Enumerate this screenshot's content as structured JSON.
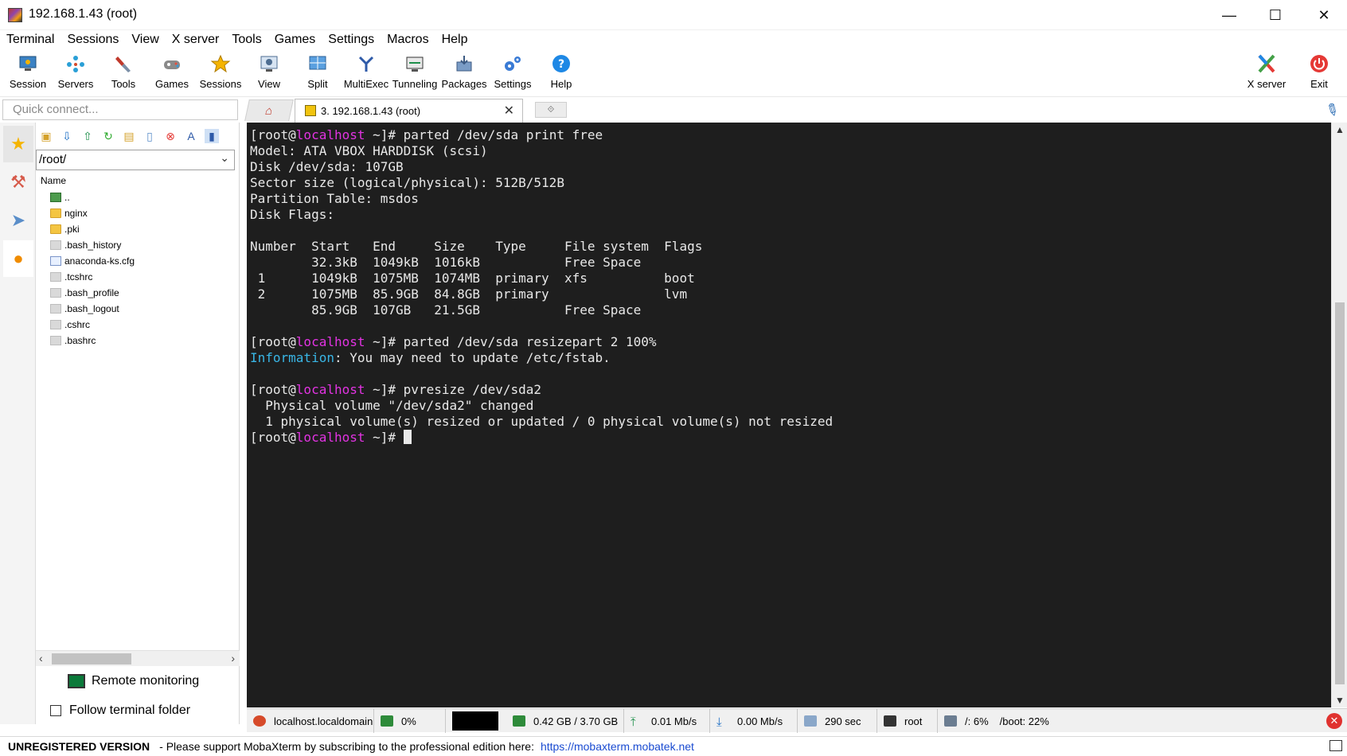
{
  "window": {
    "title": "192.168.1.43 (root)",
    "controls": {
      "minimize": "—",
      "maximize": "☐",
      "close": "✕"
    }
  },
  "menu": [
    "Terminal",
    "Sessions",
    "View",
    "X server",
    "Tools",
    "Games",
    "Settings",
    "Macros",
    "Help"
  ],
  "toolbar": [
    {
      "label": "Session",
      "icon": "session-icon"
    },
    {
      "label": "Servers",
      "icon": "servers-icon"
    },
    {
      "label": "Tools",
      "icon": "tools-icon"
    },
    {
      "label": "Games",
      "icon": "games-icon"
    },
    {
      "label": "Sessions",
      "icon": "star-icon"
    },
    {
      "label": "View",
      "icon": "view-icon"
    },
    {
      "label": "Split",
      "icon": "split-icon"
    },
    {
      "label": "MultiExec",
      "icon": "multiexec-icon"
    },
    {
      "label": "Tunneling",
      "icon": "tunneling-icon"
    },
    {
      "label": "Packages",
      "icon": "packages-icon"
    },
    {
      "label": "Settings",
      "icon": "settings-icon"
    },
    {
      "label": "Help",
      "icon": "help-icon"
    }
  ],
  "toolbar_right": [
    {
      "label": "X server",
      "icon": "xserver-icon"
    },
    {
      "label": "Exit",
      "icon": "power-icon"
    }
  ],
  "quick_connect": {
    "placeholder": "Quick connect..."
  },
  "tabs": {
    "active_label": "3. 192.168.1.43 (root)",
    "close_glyph": "✕"
  },
  "sftp": {
    "path": "/root/",
    "column_header": "Name",
    "files": [
      {
        "name": "..",
        "kind": "up"
      },
      {
        "name": "nginx",
        "kind": "folder"
      },
      {
        "name": ".pki",
        "kind": "folder"
      },
      {
        "name": ".bash_history",
        "kind": "file"
      },
      {
        "name": "anaconda-ks.cfg",
        "kind": "cfg"
      },
      {
        "name": ".tcshrc",
        "kind": "file"
      },
      {
        "name": ".bash_profile",
        "kind": "file"
      },
      {
        "name": ".bash_logout",
        "kind": "file"
      },
      {
        "name": ".cshrc",
        "kind": "file"
      },
      {
        "name": ".bashrc",
        "kind": "file"
      }
    ],
    "remote_monitoring": "Remote monitoring",
    "follow_terminal_folder": "Follow terminal folder"
  },
  "terminal": {
    "prompt_user": "[root@",
    "prompt_host": "localhost",
    "prompt_tail": " ~]# ",
    "lines": [
      {
        "type": "cmd",
        "text": "parted /dev/sda print free"
      },
      {
        "type": "out",
        "text": "Model: ATA VBOX HARDDISK (scsi)"
      },
      {
        "type": "out",
        "text": "Disk /dev/sda: 107GB"
      },
      {
        "type": "out",
        "text": "Sector size (logical/physical): 512B/512B"
      },
      {
        "type": "out",
        "text": "Partition Table: msdos"
      },
      {
        "type": "out",
        "text": "Disk Flags:"
      },
      {
        "type": "out",
        "text": ""
      },
      {
        "type": "out",
        "text": "Number  Start   End     Size    Type     File system  Flags"
      },
      {
        "type": "out",
        "text": "        32.3kB  1049kB  1016kB           Free Space"
      },
      {
        "type": "out",
        "text": " 1      1049kB  1075MB  1074MB  primary  xfs          boot"
      },
      {
        "type": "out",
        "text": " 2      1075MB  85.9GB  84.8GB  primary               lvm"
      },
      {
        "type": "out",
        "text": "        85.9GB  107GB   21.5GB           Free Space"
      },
      {
        "type": "out",
        "text": ""
      },
      {
        "type": "cmd",
        "text": "parted /dev/sda resizepart 2 100%"
      },
      {
        "type": "info",
        "label": "Information",
        "text": ": You may need to update /etc/fstab."
      },
      {
        "type": "out",
        "text": ""
      },
      {
        "type": "cmd",
        "text": "pvresize /dev/sda2"
      },
      {
        "type": "out",
        "text": "  Physical volume \"/dev/sda2\" changed"
      },
      {
        "type": "out",
        "text": "  1 physical volume(s) resized or updated / 0 physical volume(s) not resized"
      },
      {
        "type": "prompt",
        "text": ""
      }
    ]
  },
  "statusbar": {
    "hostname": "localhost.localdomain",
    "cpu": "0%",
    "memory": "0.42 GB / 3.70 GB",
    "upload": "0.01 Mb/s",
    "download": "0.00 Mb/s",
    "uptime": "290 sec",
    "user": "root",
    "disk_root": "/: 6%",
    "disk_boot": "/boot: 22%"
  },
  "footer": {
    "unregistered": "UNREGISTERED VERSION",
    "message": "-  Please support MobaXterm by subscribing to the professional edition here:",
    "link": "https://mobaxterm.mobatek.net"
  },
  "colors": {
    "terminal_bg": "#1e1e1e",
    "terminal_fg": "#e8e8e8",
    "prompt_host": "#e233e2",
    "info": "#39b6e6",
    "link": "#1a4bd1"
  }
}
